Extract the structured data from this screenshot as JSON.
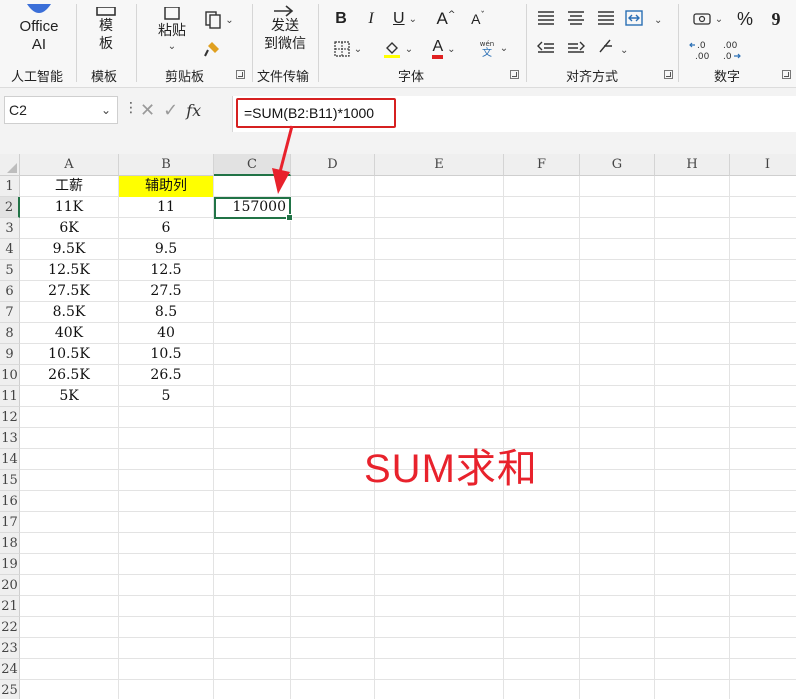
{
  "ribbon": {
    "office_ai": {
      "line1": "Office",
      "line2": "AI",
      "group": "人工智能"
    },
    "template": {
      "line1": "模",
      "line2": "板",
      "group": "模板"
    },
    "clipboard": {
      "paste": "粘贴",
      "group": "剪贴板"
    },
    "transfer": {
      "line1": "发送",
      "line2": "到微信",
      "group": "文件传输"
    },
    "font": {
      "bold": "B",
      "italic": "I",
      "underline": "U",
      "grow": "A",
      "shrink": "A",
      "font_color": "A",
      "group": "字体"
    },
    "align": {
      "group": "对齐方式"
    },
    "number": {
      "percent": "%",
      "comma": "9",
      "inc_decimal": "←.0 .00",
      "dec_decimal": ".00 →.0",
      "group": "数字"
    }
  },
  "formula_bar": {
    "name_box": "C2",
    "fx": "fx",
    "formula": "=SUM(B2:B11)*1000"
  },
  "sheet": {
    "columns": [
      "A",
      "B",
      "C",
      "D",
      "E",
      "F",
      "G",
      "H",
      "I"
    ],
    "selected_column": "C",
    "rows": [
      "1",
      "2",
      "3",
      "4",
      "5",
      "6",
      "7",
      "8",
      "9",
      "10",
      "11",
      "12",
      "13",
      "14",
      "15",
      "16",
      "17",
      "18",
      "19",
      "20",
      "21",
      "22",
      "23",
      "24",
      "25"
    ],
    "selected_row": "2",
    "col_a": [
      "工薪",
      "11K",
      "6K",
      "9.5K",
      "12.5K",
      "27.5K",
      "8.5K",
      "40K",
      "10.5K",
      "26.5K",
      "5K"
    ],
    "col_b": [
      "辅助列",
      "11",
      "6",
      "9.5",
      "12.5",
      "27.5",
      "8.5",
      "40",
      "10.5",
      "26.5",
      "5"
    ],
    "c2": "157000",
    "highlight_color": "#ffff00",
    "selection_color": "#217346"
  },
  "annotation": {
    "text": "SUM求和",
    "color": "#e8222c"
  }
}
